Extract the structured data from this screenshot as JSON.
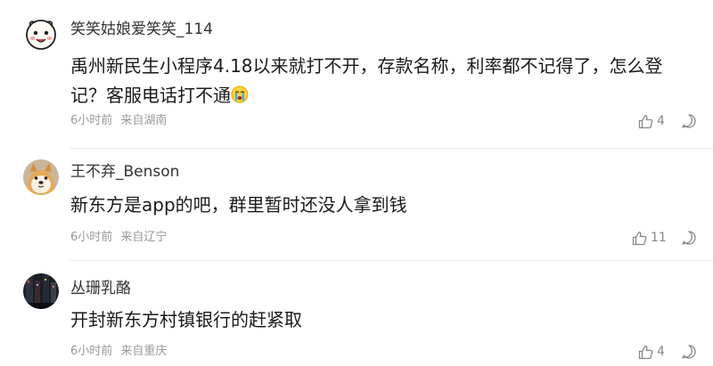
{
  "comments": [
    {
      "username": "笑笑姑娘爱笑笑_114",
      "text_line1": "禹州新民生小程序4.18以来就打不开，存款名称，利率都不记得了，怎么登",
      "text_line2": "记？客服电话打不通",
      "emoji": "crying-face-icon",
      "time": "6小时前",
      "location": "来自湖南",
      "likes": "4",
      "avatar": "cartoon-bun-avatar-icon"
    },
    {
      "username": "王不弃_Benson",
      "text_line1": "新东方是app的吧，群里暂时还没人拿到钱",
      "time": "6小时前",
      "location": "来自辽宁",
      "likes": "11",
      "avatar": "shiba-dog-avatar-icon"
    },
    {
      "username": "丛珊乳酪",
      "text_line1": "开封新东方村镇银行的赶紧取",
      "time": "6小时前",
      "location": "来自重庆",
      "likes": "4",
      "avatar": "dark-photo-avatar-icon"
    }
  ],
  "colors": {
    "text": "#1a1a1a",
    "meta": "#999999",
    "icon": "#888888",
    "divider": "#e8e8e8"
  }
}
